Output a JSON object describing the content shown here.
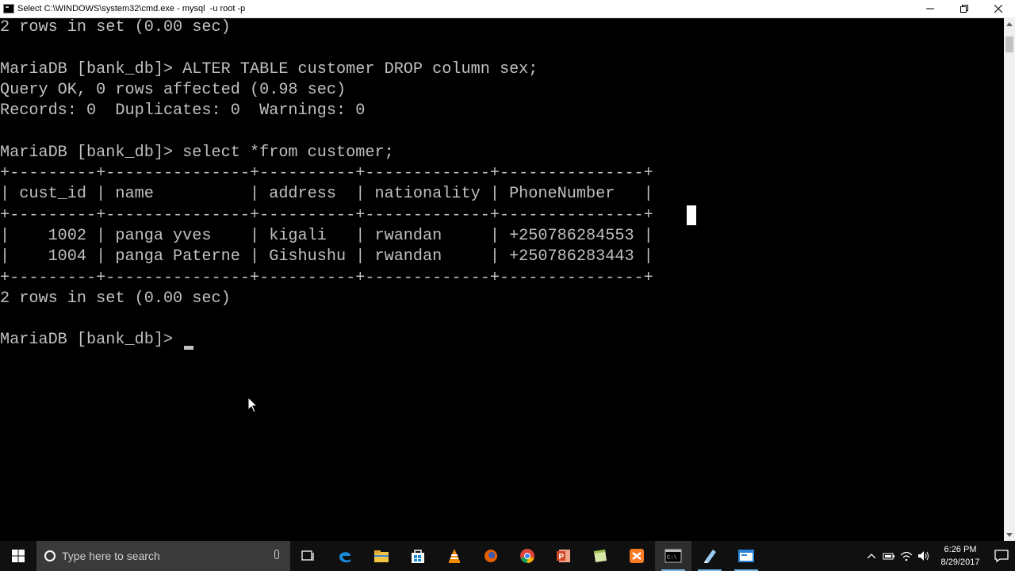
{
  "window": {
    "title": "Select C:\\WINDOWS\\system32\\cmd.exe - mysql  -u root -p",
    "minimize_icon": "minimize-icon",
    "maximize_icon": "restore-icon",
    "close_icon": "close-icon"
  },
  "console": {
    "lines": [
      "2 rows in set (0.00 sec)",
      "",
      "MariaDB [bank_db]> ALTER TABLE customer DROP column sex;",
      "Query OK, 0 rows affected (0.98 sec)",
      "Records: 0  Duplicates: 0  Warnings: 0",
      "",
      "MariaDB [bank_db]> select *from customer;",
      "+---------+---------------+----------+-------------+---------------+",
      "| cust_id | name          | address  | nationality | PhoneNumber   |",
      "+---------+---------------+----------+-------------+---------------+",
      "|    1002 | panga yves    | kigali   | rwandan     | +250786284553 |",
      "|    1004 | panga Paterne | Gishushu | rwandan     | +250786283443 |",
      "+---------+---------------+----------+-------------+---------------+",
      "2 rows in set (0.00 sec)",
      "",
      "MariaDB [bank_db]> "
    ]
  },
  "taskbar": {
    "search_placeholder": "Type here to search",
    "apps": [
      {
        "name": "task-view-icon",
        "open": false
      },
      {
        "name": "edge-icon",
        "open": false
      },
      {
        "name": "file-explorer-icon",
        "open": false
      },
      {
        "name": "store-icon",
        "open": false
      },
      {
        "name": "vlc-icon",
        "open": false
      },
      {
        "name": "firefox-icon",
        "open": false
      },
      {
        "name": "chrome-icon",
        "open": false
      },
      {
        "name": "powerpoint-icon",
        "open": false
      },
      {
        "name": "notes-icon",
        "open": false
      },
      {
        "name": "xampp-icon",
        "open": false
      },
      {
        "name": "cmd-icon",
        "open": true
      },
      {
        "name": "paint-icon",
        "open": true
      },
      {
        "name": "window-app-icon",
        "open": true
      }
    ],
    "time": "6:26 PM",
    "date": "8/29/2017"
  },
  "colors": {
    "console_bg": "#000000",
    "console_fg": "#c0c0c0",
    "taskbar_bg": "#101010",
    "accent": "#76b9ed"
  }
}
